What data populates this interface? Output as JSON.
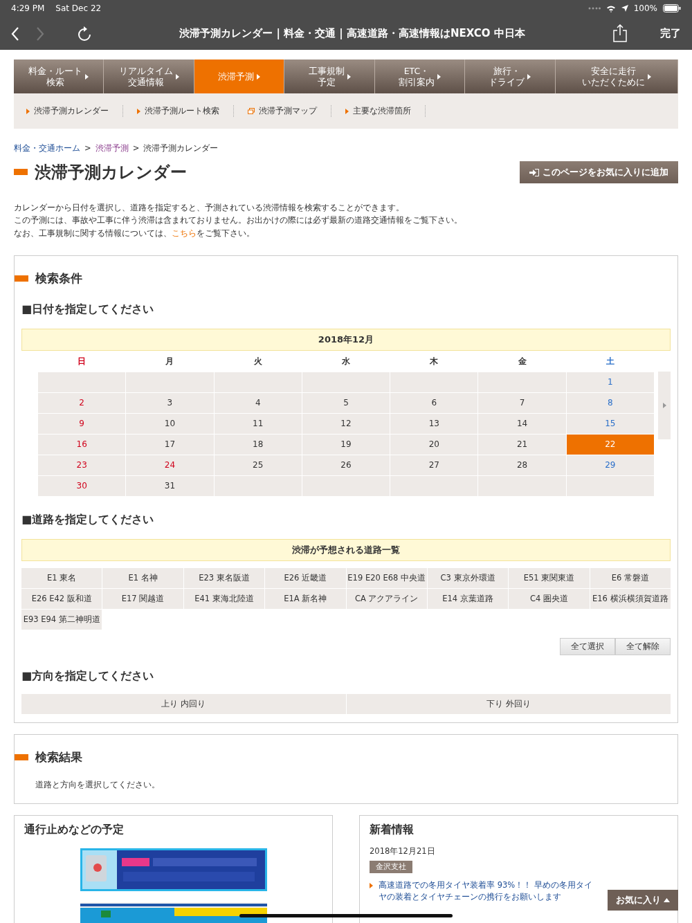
{
  "status_bar": {
    "time": "4:29 PM",
    "date": "Sat Dec 22",
    "battery_text": "100%"
  },
  "browser": {
    "title": "渋滞予測カレンダー | 料金・交通 | 高速道路・高速情報はNEXCO 中日本",
    "done": "完了"
  },
  "main_nav": [
    {
      "lines": [
        "料金・ルート",
        "検索"
      ],
      "selected": false
    },
    {
      "lines": [
        "リアルタイム",
        "交通情報"
      ],
      "selected": false
    },
    {
      "lines": [
        "渋滞予測"
      ],
      "selected": true
    },
    {
      "lines": [
        "工事規制",
        "予定"
      ],
      "selected": false
    },
    {
      "lines": [
        "ETC・",
        "割引案内"
      ],
      "selected": false
    },
    {
      "lines": [
        "旅行・",
        "ドライブ"
      ],
      "selected": false
    },
    {
      "lines": [
        "安全に走行",
        "いただくために"
      ],
      "selected": false
    }
  ],
  "sub_nav": [
    {
      "label": "渋滞予測カレンダー",
      "kind": "arrow"
    },
    {
      "label": "渋滞予測ルート検索",
      "kind": "arrow"
    },
    {
      "label": "渋滞予測マップ",
      "kind": "window"
    },
    {
      "label": "主要な渋滞箇所",
      "kind": "arrow"
    }
  ],
  "breadcrumb": [
    {
      "label": "料金・交通ホーム",
      "kind": "link"
    },
    {
      "label": ">",
      "kind": "separator"
    },
    {
      "label": "渋滞予測",
      "kind": "visited"
    },
    {
      "label": ">",
      "kind": "separator"
    },
    {
      "label": "渋滞予測カレンダー",
      "kind": "current"
    }
  ],
  "page_title": "渋滞予測カレンダー",
  "favorite_button": "このページをお気に入りに追加",
  "intro": [
    {
      "text": "カレンダーから日付を選択し、道路を指定すると、予測されている渋滞情報を検索することができます。"
    },
    {
      "text": "この予測には、事故や工事に伴う渋滞は含まれておりません。お出かけの際には必ず最新の道路交通情報をご覧下さい。"
    },
    {
      "text": "なお、工事規制に関する情報については、",
      "link": "こちら",
      "after": "をご覧下さい。"
    }
  ],
  "search": {
    "title": "検索条件",
    "date_heading": "■日付を指定してください",
    "month": "2018年12月",
    "weekdays": [
      {
        "label": "日",
        "kind": "holiday"
      },
      {
        "label": "月",
        "kind": "weekday"
      },
      {
        "label": "火",
        "kind": "weekday"
      },
      {
        "label": "水",
        "kind": "weekday"
      },
      {
        "label": "木",
        "kind": "weekday"
      },
      {
        "label": "金",
        "kind": "weekday"
      },
      {
        "label": "土",
        "kind": "saturday"
      }
    ],
    "weeks": [
      [
        {
          "kind": "blank"
        },
        {
          "kind": "blank"
        },
        {
          "kind": "blank"
        },
        {
          "kind": "blank"
        },
        {
          "kind": "blank"
        },
        {
          "kind": "blank"
        },
        {
          "day": "1",
          "kind": "saturday",
          "selected": false
        }
      ],
      [
        {
          "day": "2",
          "kind": "holiday",
          "selected": false
        },
        {
          "day": "3",
          "kind": "weekday",
          "selected": false
        },
        {
          "day": "4",
          "kind": "weekday",
          "selected": false
        },
        {
          "day": "5",
          "kind": "weekday",
          "selected": false
        },
        {
          "day": "6",
          "kind": "weekday",
          "selected": false
        },
        {
          "day": "7",
          "kind": "weekday",
          "selected": false
        },
        {
          "day": "8",
          "kind": "saturday",
          "selected": false
        }
      ],
      [
        {
          "day": "9",
          "kind": "holiday",
          "selected": false
        },
        {
          "day": "10",
          "kind": "weekday",
          "selected": false
        },
        {
          "day": "11",
          "kind": "weekday",
          "selected": false
        },
        {
          "day": "12",
          "kind": "weekday",
          "selected": false
        },
        {
          "day": "13",
          "kind": "weekday",
          "selected": false
        },
        {
          "day": "14",
          "kind": "weekday",
          "selected": false
        },
        {
          "day": "15",
          "kind": "saturday",
          "selected": false
        }
      ],
      [
        {
          "day": "16",
          "kind": "holiday",
          "selected": false
        },
        {
          "day": "17",
          "kind": "weekday",
          "selected": false
        },
        {
          "day": "18",
          "kind": "weekday",
          "selected": false
        },
        {
          "day": "19",
          "kind": "weekday",
          "selected": false
        },
        {
          "day": "20",
          "kind": "weekday",
          "selected": false
        },
        {
          "day": "21",
          "kind": "weekday",
          "selected": false
        },
        {
          "day": "22",
          "kind": "saturday",
          "selected": true
        }
      ],
      [
        {
          "day": "23",
          "kind": "holiday",
          "selected": false
        },
        {
          "day": "24",
          "kind": "holiday",
          "selected": false
        },
        {
          "day": "25",
          "kind": "weekday",
          "selected": false
        },
        {
          "day": "26",
          "kind": "weekday",
          "selected": false
        },
        {
          "day": "27",
          "kind": "weekday",
          "selected": false
        },
        {
          "day": "28",
          "kind": "weekday",
          "selected": false
        },
        {
          "day": "29",
          "kind": "saturday",
          "selected": false
        }
      ],
      [
        {
          "day": "30",
          "kind": "holiday",
          "selected": false
        },
        {
          "day": "31",
          "kind": "weekday",
          "selected": false
        },
        {
          "kind": "blank"
        },
        {
          "kind": "blank"
        },
        {
          "kind": "blank"
        },
        {
          "kind": "blank"
        },
        {
          "kind": "blank"
        }
      ]
    ],
    "road_heading": "■道路を指定してください",
    "road_list_title": "渋滞が予想される道路一覧",
    "roads": [
      "E1 東名",
      "E1 名神",
      "E23 東名阪道",
      "E26 近畿道",
      "E19 E20 E68 中央道",
      "C3 東京外環道",
      "E51 東関東道",
      "E6 常磐道",
      "E26 E42 阪和道",
      "E17 関越道",
      "E41 東海北陸道",
      "E1A 新名神",
      "CA アクアライン",
      "E14 京葉道路",
      "C4 圏央道",
      "E16 横浜横須賀道路",
      "E93 E94 第二神明道"
    ],
    "select_all": "全て選択",
    "clear_all": "全て解除",
    "direction_heading": "■方向を指定してください",
    "directions": [
      "上り 内回り",
      "下り 外回り"
    ]
  },
  "results": {
    "title": "検索結果",
    "message": "道路と方向を選択してください。"
  },
  "schedule": {
    "title": "通行止めなどの予定"
  },
  "news": {
    "title": "新着情報",
    "items": [
      {
        "date": "2018年12月21日",
        "tag": "金沢支社",
        "text": "高速道路での冬用タイヤ装着率 93%！！ 早めの冬用タイヤの装着とタイヤチェーンの携行をお願いします"
      }
    ]
  },
  "floating_favorite": "お気に入り"
}
